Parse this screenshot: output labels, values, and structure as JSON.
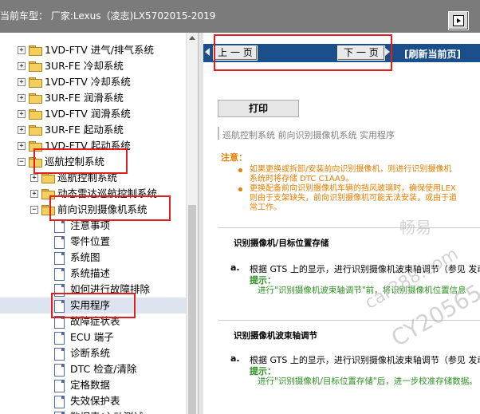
{
  "window": {
    "title": "当前车型： 厂家:Lexus（凌志)LX5702015-2019"
  },
  "tree": {
    "items": [
      {
        "label": "1VD-FTV 进气/排气系统",
        "type": "folder",
        "expander": "+"
      },
      {
        "label": "3UR-FE 冷却系统",
        "type": "folder",
        "expander": "+"
      },
      {
        "label": "1VD-FTV 冷却系统",
        "type": "folder",
        "expander": "+"
      },
      {
        "label": "3UR-FE 润滑系统",
        "type": "folder",
        "expander": "+"
      },
      {
        "label": "1VD-FTV 润滑系统",
        "type": "folder",
        "expander": "+"
      },
      {
        "label": "3UR-FE 起动系统",
        "type": "folder",
        "expander": "+"
      },
      {
        "label": "1VD-FTV 起动系统",
        "type": "folder",
        "expander": "+"
      },
      {
        "label": "巡航控制系统",
        "type": "folder",
        "expander": "−"
      },
      {
        "label": "巡航控制系统",
        "type": "folder",
        "expander": "+"
      },
      {
        "label": "动态雷达巡航控制系统",
        "type": "folder",
        "expander": "+"
      },
      {
        "label": "前向识别摄像机系统",
        "type": "folder",
        "expander": "−"
      },
      {
        "label": "注意事项",
        "type": "doc"
      },
      {
        "label": "零件位置",
        "type": "doc"
      },
      {
        "label": "系统图",
        "type": "doc"
      },
      {
        "label": "系统描述",
        "type": "doc"
      },
      {
        "label": "如何进行故障排除",
        "type": "doc"
      },
      {
        "label": "实用程序",
        "type": "doc"
      },
      {
        "label": "故障症状表",
        "type": "doc"
      },
      {
        "label": "ECU 端子",
        "type": "doc"
      },
      {
        "label": "诊断系统",
        "type": "doc"
      },
      {
        "label": "DTC 检查/清除",
        "type": "doc"
      },
      {
        "label": "定格数据",
        "type": "doc"
      },
      {
        "label": "失效保护表",
        "type": "doc"
      },
      {
        "label": "数据表/主动测试",
        "type": "doc"
      }
    ]
  },
  "nav": {
    "prev_label": "上 一 页",
    "next_label": "下 一 页",
    "refresh_label": "[刷新当前页]"
  },
  "content": {
    "print_label": "打印",
    "breadcrumb": "巡航控制系统  前向识别摄像机系统  实用程序",
    "note_label": "注意：",
    "notes": [
      "如果更换或拆卸/安装前向识别摄像机，则进行识别摄像机",
      "系统时将存储 DTC C1AA9。",
      "更换配备前向识别摄像机车辆的挡风玻璃时，确保使用LEX",
      "则由于支架缺失，前向识别摄像机可能无法安装，或由于道",
      "常工作。"
    ],
    "section1": {
      "title": "识别摄像机/目标位置存储",
      "step_letter": "a.",
      "step_text": "根据 GTS 上的显示，进行识别摄像机波束轴调节（参见 发动",
      "hint_label": "提示：",
      "hint_text": "进行\"识别摄像机波束轴调节\"前，将识别摄像机位置信息"
    },
    "section2": {
      "title": "识别摄像机波束轴调节",
      "step_letter": "a.",
      "step_text": "根据 GTS 上的显示，进行识别摄像机波束轴调节（参见 发动",
      "hint_label": "提示：",
      "hint_text": "进行\"识别摄像机/目标位置存储\"后，进一步校准存储数据。"
    }
  },
  "watermark": {
    "cn": "畅易",
    "url": "car388.com",
    "code": "CY20565"
  },
  "colors": {
    "nav_bar": "#1a4f8c",
    "note": "#e67e00",
    "hint": "#2a8f1f",
    "highlight": "#e02020"
  }
}
